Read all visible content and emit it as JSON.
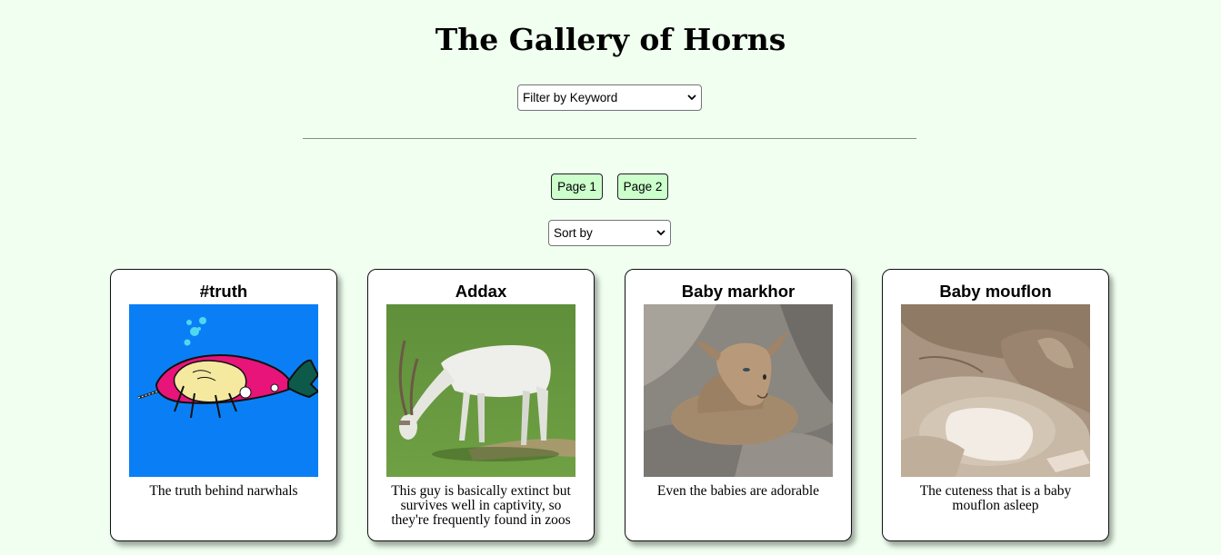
{
  "page": {
    "title": "The Gallery of Horns"
  },
  "filter": {
    "selected": "Filter by Keyword"
  },
  "pagination": {
    "buttons": [
      "Page 1",
      "Page 2"
    ]
  },
  "sort": {
    "selected": "Sort by"
  },
  "cards": [
    {
      "title": "#truth",
      "description": "The truth behind narwhals",
      "image_icon": "narwhal-illustration"
    },
    {
      "title": "Addax",
      "description": "This guy is basically extinct but survives well in captivity, so they're frequently found in zoos",
      "image_icon": "addax-photo"
    },
    {
      "title": "Baby markhor",
      "description": "Even the babies are adorable",
      "image_icon": "baby-markhor-photo"
    },
    {
      "title": "Baby mouflon",
      "description": "The cuteness that is a baby mouflon asleep",
      "image_icon": "baby-mouflon-photo"
    }
  ],
  "colors": {
    "page_background": "#f0fff0",
    "button_background": "#ccffcc"
  }
}
